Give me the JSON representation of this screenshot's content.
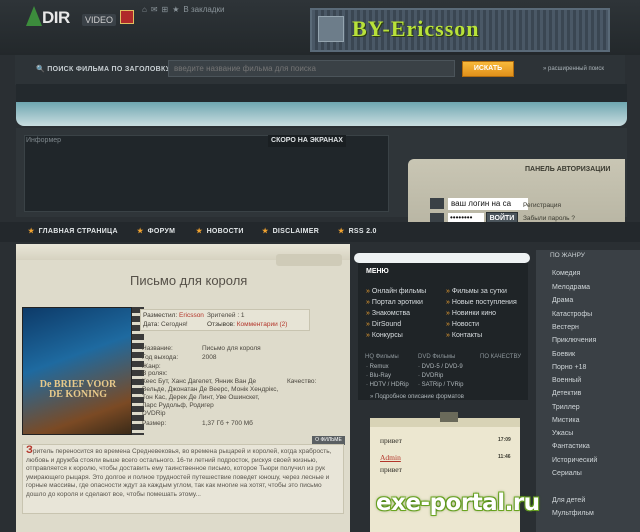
{
  "header": {
    "logo_dir": "DIR",
    "logo_video": "VIDEO",
    "bookmark_label": "В закладки",
    "banner_text": "BY-Ericsson"
  },
  "search": {
    "label": "ПОИСК ФИЛЬМА ПО ЗАГОЛОВКУ",
    "placeholder": "введите название фильма для поиска",
    "button": "ИСКАТЬ",
    "advanced": "» расширенный поиск"
  },
  "informer": {
    "label": "Информер",
    "tab": "СКОРО НА ЭКРАНАХ"
  },
  "auth": {
    "title": "ПАНЕЛЬ АВТОРИЗАЦИИ",
    "login_value": "ваш логин на са",
    "password_value": "••••••••",
    "login_button": "ВОЙТИ",
    "register": "Регистрация",
    "forgot": "Забыли пароль ?"
  },
  "nav": {
    "items": [
      "ГЛАВНАЯ СТРАНИЦА",
      "ФОРУМ",
      "НОВОСТИ",
      "DISCLAIMER",
      "RSS 2.0"
    ]
  },
  "article": {
    "title": "Письмо для короля",
    "poster_text": "De BRIEF VOOR DE KONING",
    "meta": {
      "author_label": "Разместил:",
      "author": "Ericsson",
      "views_label": "Зрителей : 1",
      "date_label": "Дата:",
      "date": "Сегодня!",
      "reviews_label": "Отзывов:",
      "reviews": "Комментарии (2)"
    },
    "details": {
      "name_label": "Название:",
      "name": "Письмо для короля",
      "year_label": "Год выхода:",
      "year": "2008",
      "genre_label": "Жанр:",
      "roles_label": "В ролях:",
      "cast_1": "Кеес Бут, Ханс Дагелет, Янник Ван Де",
      "quality_label": "Качество:",
      "cast_2": "Вельде, Джонатан Де Веерс, Монік Хендрікс,",
      "cast_3": "Тон Кас, Дерек Де Линт, Уве Ошинскет,",
      "cast_4": "Ларс Рудольф, Родигер",
      "format": "DVDRip",
      "size_label": "Размер:",
      "size": "1,37 Гб + 700 Мб"
    },
    "badge": "О ФИЛЬМЕ",
    "desc_cap": "З",
    "description": "ритель переносится во времена Средневековья, во времена рыцарей и королей, когда храбрость, любовь и дружба стояли выше всего остального. 16-ти летний подросток, рискуя своей жизнью, отправляется к королю, чтобы доставить ему таинственное письмо, которое Тьюри получил из рук умирающего рыцаря. Это долгое и полное трудностей путешествие поведет юношу, через лесные и горные массивы, где опасности ждут за каждым углом, так как многие на хотят, чтобы это письмо дошло до короля и сделают все, чтобы помешать этому..."
  },
  "menu": {
    "title": "МЕНЮ",
    "left": [
      "Онлайн фильмы",
      "Портал эротики",
      "Знакомства",
      "DirSound",
      "Конкурсы"
    ],
    "right": [
      "Фильмы за сутки",
      "Новые поступления",
      "Новинки кино",
      "Новости",
      "Контакты"
    ],
    "hq_head": "HQ Фильмы",
    "dvd_head": "DVD Фильмы",
    "quality_head": "ПО КАЧЕСТВУ",
    "hq": [
      "· Remux",
      "· Blu-Ray",
      "· HDTV / HDRip"
    ],
    "dvd": [
      "· DVD-5 / DVD-9",
      "· DVDRip",
      "· SATRip / TVRip"
    ],
    "formats": "» Подробное описание форматов"
  },
  "chat": [
    {
      "user": "",
      "text": "привет",
      "time": "17:09"
    },
    {
      "user": "Admin",
      "text": "привет",
      "time": "11:46"
    }
  ],
  "genres": {
    "head": "ПО ЖАНРУ",
    "items": [
      "Комедия",
      "Мелодрама",
      "Драма",
      "Катастрофы",
      "Вестерн",
      "Приключения",
      "Боевик",
      "Порно +18",
      "Военный",
      "Детектив",
      "Триллер",
      "Мистика",
      "Ужасы",
      "Фантастика",
      "Исторический",
      "Сериалы",
      "Для детей",
      "Мультфильм"
    ]
  },
  "watermark": "exe-portal.ru"
}
